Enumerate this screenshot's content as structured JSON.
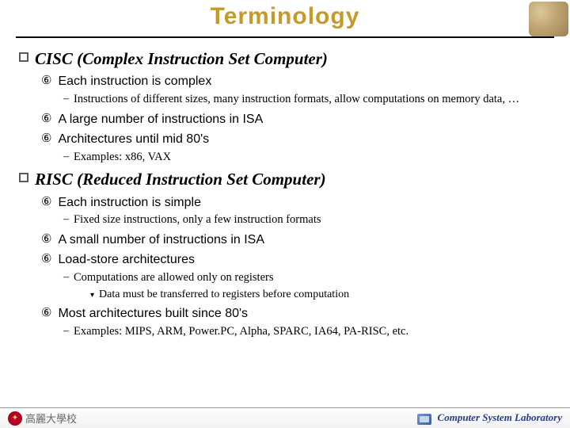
{
  "title": "Terminology",
  "sections": [
    {
      "heading": "CISC (Complex Instruction Set Computer)",
      "items": [
        {
          "text": "Each instruction is complex",
          "sub": [
            {
              "text": "Instructions of different sizes, many instruction formats, allow computations on memory data, …"
            }
          ]
        },
        {
          "text": "A large number of instructions in ISA"
        },
        {
          "text": "Architectures until mid 80's",
          "sub": [
            {
              "text": "Examples: x86, VAX"
            }
          ]
        }
      ]
    },
    {
      "heading": "RISC (Reduced Instruction Set Computer)",
      "items": [
        {
          "text": "Each instruction is simple",
          "sub": [
            {
              "text": "Fixed size instructions, only a few instruction formats"
            }
          ]
        },
        {
          "text": "A small number of instructions in ISA"
        },
        {
          "text": "Load-store architectures",
          "sub": [
            {
              "text": "Computations are allowed only on registers",
              "sub": [
                {
                  "text": "Data must be transferred to registers before computation"
                }
              ]
            }
          ]
        },
        {
          "text": "Most architectures built since 80's",
          "sub": [
            {
              "text": "Examples: MIPS, ARM, Power.PC, Alpha, SPARC, IA64, PA-RISC, etc."
            }
          ]
        }
      ]
    }
  ],
  "footer": {
    "university": "高麗大學校",
    "lab": "Computer System Laboratory"
  }
}
